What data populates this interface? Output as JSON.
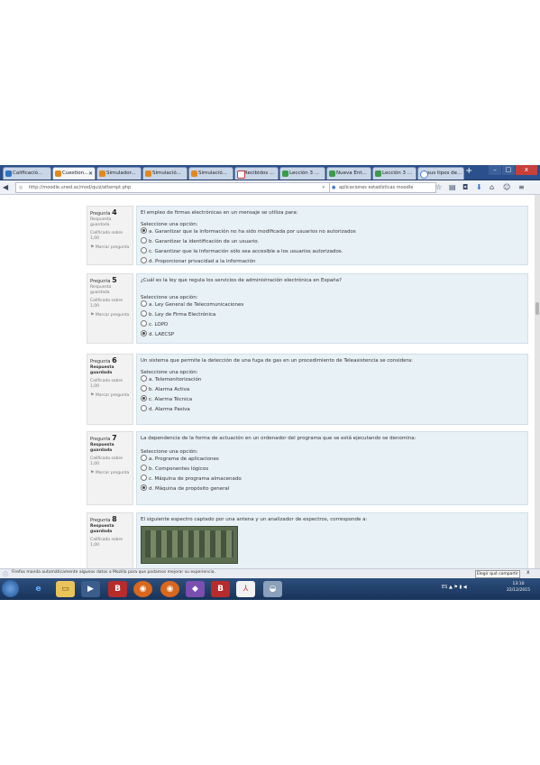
{
  "browser": {
    "tabs": [
      {
        "label": "Calificació...",
        "icon": "doc-icon-blue"
      },
      {
        "label": "Cuestion...",
        "icon": "moodle-icon"
      },
      {
        "label": "Simulador...",
        "icon": "moodle-icon"
      },
      {
        "label": "Simulació...",
        "icon": "moodle-icon"
      },
      {
        "label": "Simulació...",
        "icon": "moodle-icon"
      },
      {
        "label": "Recibidos ...",
        "icon": "gmail-icon"
      },
      {
        "label": "Lección 3 ...",
        "icon": "drive-icon"
      },
      {
        "label": "Nueva Ent...",
        "icon": "drive-icon"
      },
      {
        "label": "Lección 3 ...",
        "icon": "drive-icon"
      },
      {
        "label": "sus tipos de...",
        "icon": "google-icon"
      }
    ],
    "new_tab": "+",
    "url": "http://moodle.uned.ac/mod/quiz/attempt.php",
    "search": "aplicaciones estadísticas moodle",
    "window": {
      "minimize": "–",
      "maximize": "□",
      "close": "x"
    }
  },
  "questions": [
    {
      "label": "Pregunta",
      "number": "4",
      "state": "Respuesta guardada",
      "grade": "Calificado sobre 1,00",
      "flag": "Marcar pregunta",
      "text": "El empleo de firmas electrónicas en un mensaje se utiliza para:",
      "prompt": "Seleccione una opción:",
      "options": [
        {
          "label": "a. Garantizar que la información no ha sido modificada por usuarios no autorizados",
          "checked": true
        },
        {
          "label": "b. Garantizar la identificación de un usuario.",
          "checked": false
        },
        {
          "label": "c. Garantizar que la información sólo sea accesible a los usuarios autorizados.",
          "checked": false
        },
        {
          "label": "d. Proporcionar privacidad a la información",
          "checked": false
        }
      ]
    },
    {
      "label": "Pregunta",
      "number": "5",
      "state": "Respuesta guardada",
      "grade": "Calificado sobre 1,00",
      "flag": "Marcar pregunta",
      "text": "¿Cuál es la ley que regula los servicios de administración electrónica en España?",
      "prompt": "Seleccione una opción:",
      "options": [
        {
          "label": "a. Ley General de Telecomunicaciones",
          "checked": false
        },
        {
          "label": "b. Ley de Firma Electrónica",
          "checked": false
        },
        {
          "label": "c. LOPD",
          "checked": false
        },
        {
          "label": "d. LAECSP",
          "checked": true
        }
      ]
    },
    {
      "label": "Pregunta",
      "number": "6",
      "state": "Respuesta guardada",
      "grade": "Calificado sobre 1,00",
      "flag": "Marcar pregunta",
      "text": "Un sistema que permite la detección de una fuga de gas en un procedimiento de Teleasistencia se considera:",
      "prompt": "Seleccione una opción:",
      "options": [
        {
          "label": "a. Telemonitorización",
          "checked": false
        },
        {
          "label": "b. Alarma Activa",
          "checked": false
        },
        {
          "label": "c. Alarma Técnica",
          "checked": true
        },
        {
          "label": "d. Alarma Pasiva",
          "checked": false
        }
      ]
    },
    {
      "label": "Pregunta",
      "number": "7",
      "state": "Respuesta guardada",
      "grade": "Calificado sobre 1,00",
      "flag": "Marcar pregunta",
      "text": "La dependencia de la forma de actuación en un ordenador del programa que se está ejecutando se denomina:",
      "prompt": "Seleccione una opción:",
      "options": [
        {
          "label": "a. Programa de aplicaciones",
          "checked": false
        },
        {
          "label": "b. Componentes lógicos",
          "checked": false
        },
        {
          "label": "c. Máquina de programa almacenado",
          "checked": false
        },
        {
          "label": "d. Máquina de propósito general",
          "checked": true
        }
      ]
    },
    {
      "label": "Pregunta",
      "number": "8",
      "state": "Respuesta guardada",
      "grade": "Calificado sobre 1,00",
      "flag": "",
      "text": "El siguiente espectro captado por una antena y un analizador de espectros, corresponde a:",
      "prompt": "",
      "options": []
    }
  ],
  "status_bar": {
    "message": "Firefox manda automáticamente algunos datos a Mozilla para que podamos mejorar su experiencia.",
    "button": "Elegir qué compartir",
    "close": "x"
  },
  "taskbar": {
    "tray": "ES",
    "time": "13:10",
    "date": "22/12/2015"
  }
}
